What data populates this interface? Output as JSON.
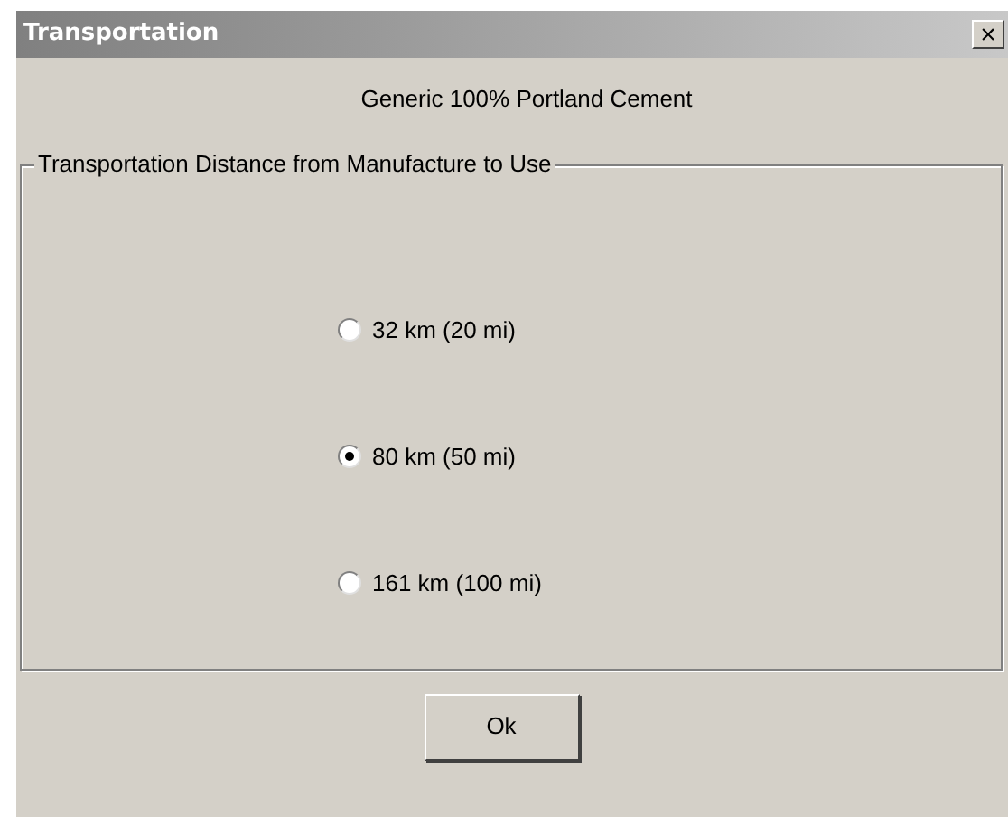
{
  "window": {
    "title": "Transportation",
    "close": "×"
  },
  "subtitle": "Generic 100% Portland Cement",
  "group": {
    "label": "Transportation Distance from Manufacture to Use",
    "options": [
      {
        "label": "32 km (20 mi)",
        "selected": false
      },
      {
        "label": "80 km (50 mi)",
        "selected": true
      },
      {
        "label": "161 km (100 mi)",
        "selected": false
      }
    ]
  },
  "buttons": [
    "Ok"
  ]
}
